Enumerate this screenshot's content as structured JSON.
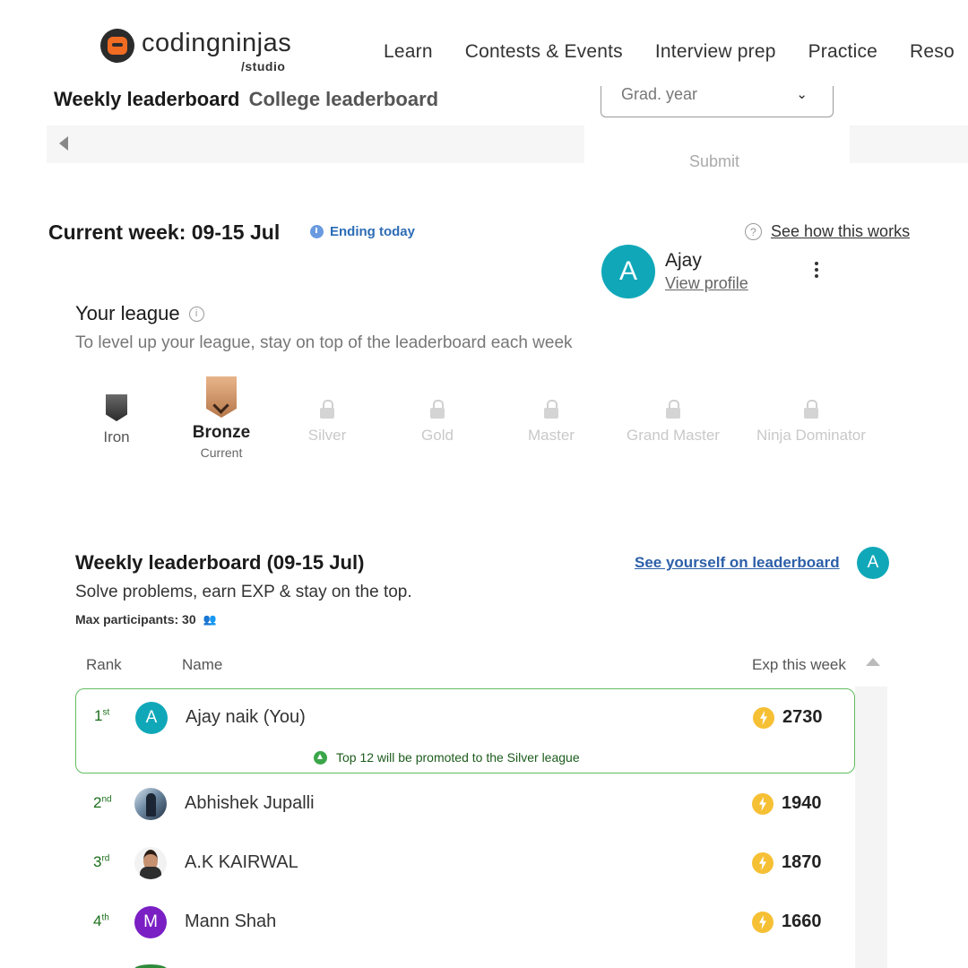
{
  "nav": {
    "logo_text": "codingninjas",
    "logo_sub": "/studio",
    "links": [
      "Learn",
      "Contests & Events",
      "Interview prep",
      "Practice",
      "Reso"
    ]
  },
  "tabs": {
    "weekly": "Weekly leaderboard",
    "college": "College leaderboard"
  },
  "filter": {
    "grad_year_placeholder": "Grad. year",
    "submit_label": "Submit"
  },
  "week": {
    "title": "Current week: 09-15 Jul",
    "status": "Ending today",
    "how_it_works": "See how this works",
    "help_icon_glyph": "?"
  },
  "profile": {
    "initial": "A",
    "name": "Ajay",
    "view_profile": "View profile",
    "avatar_color": "#10a8b9"
  },
  "league": {
    "title": "Your league",
    "info_glyph": "i",
    "subtitle": "To level up your league, stay on top of the leaderboard each week",
    "tiers": [
      {
        "label": "Iron",
        "state": "completed"
      },
      {
        "label": "Bronze",
        "state": "current",
        "status": "Current"
      },
      {
        "label": "Silver",
        "state": "locked"
      },
      {
        "label": "Gold",
        "state": "locked"
      },
      {
        "label": "Master",
        "state": "locked"
      },
      {
        "label": "Grand Master",
        "state": "locked"
      },
      {
        "label": "Ninja Dominator",
        "state": "locked"
      }
    ]
  },
  "leaderboard": {
    "title": "Weekly leaderboard (09-15 Jul)",
    "subtitle": "Solve problems, earn EXP & stay on the top.",
    "max_participants": "Max participants: 30",
    "see_yourself": "See yourself on leaderboard",
    "self_initial": "A",
    "columns": {
      "rank": "Rank",
      "name": "Name",
      "exp": "Exp this week"
    },
    "promotion_note": "Top 12 will be promoted to the Silver league",
    "rows": [
      {
        "rank": "1",
        "suffix": "st",
        "initial": "A",
        "name": "Ajay naik (You)",
        "exp": "2730",
        "avatar_color": "#10a8b9",
        "highlight": true
      },
      {
        "rank": "2",
        "suffix": "nd",
        "initial": "",
        "name": "Abhishek Jupalli",
        "exp": "1940",
        "avatar": "photo"
      },
      {
        "rank": "3",
        "suffix": "rd",
        "initial": "",
        "name": "A.K KAIRWAL",
        "exp": "1870",
        "avatar": "photo"
      },
      {
        "rank": "4",
        "suffix": "th",
        "initial": "M",
        "name": "Mann Shah",
        "exp": "1660",
        "avatar_color": "#7a1fc4"
      }
    ]
  },
  "colors": {
    "accent_teal": "#10a8b9",
    "link_blue": "#2d5fa8",
    "highlight_green": "#5fbd5f",
    "exp_bolt": "#f6c035",
    "bronze": "#c98a5a"
  }
}
